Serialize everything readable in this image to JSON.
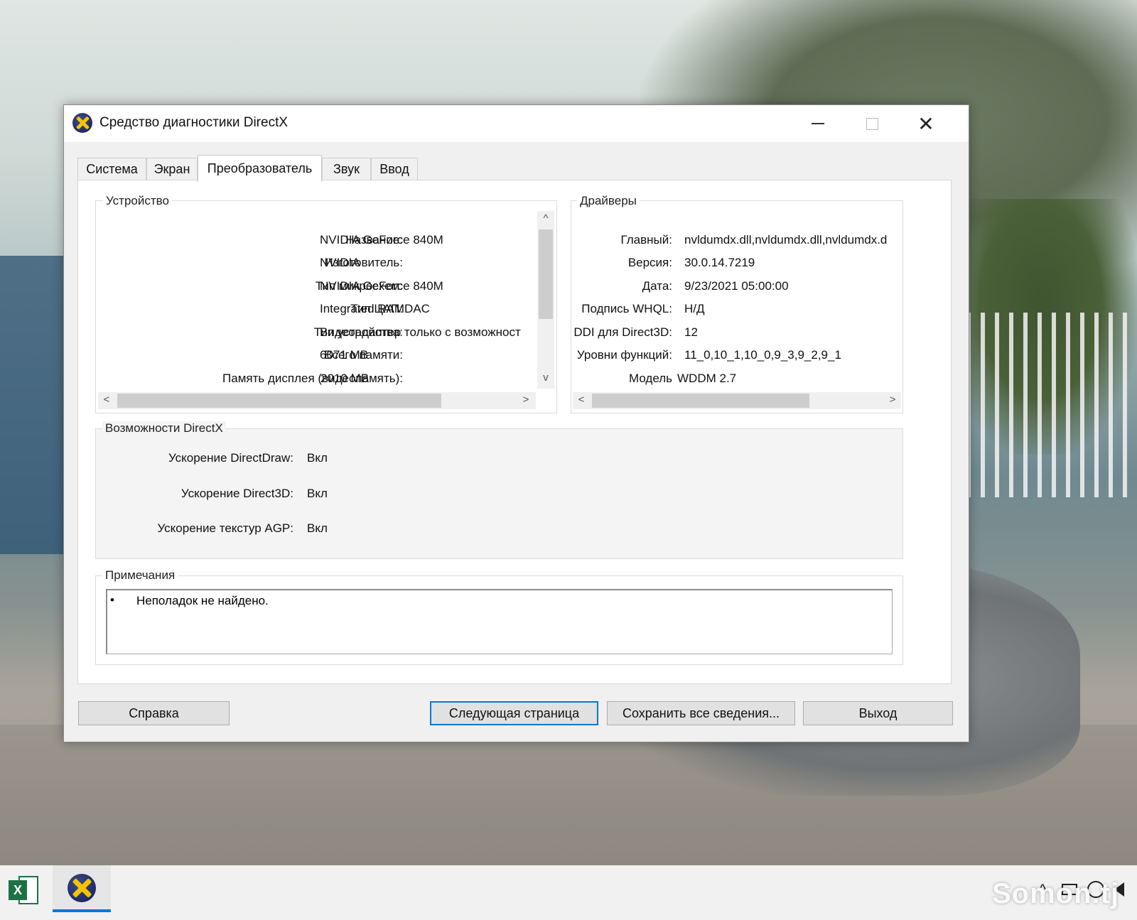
{
  "window": {
    "title": "Средство диагностики DirectX",
    "controls": {
      "minimize": "—",
      "maximize": "☐",
      "close": "✕"
    }
  },
  "tabs": [
    {
      "label": "Система",
      "active": false
    },
    {
      "label": "Экран",
      "active": false
    },
    {
      "label": "Преобразователь",
      "active": true
    },
    {
      "label": "Звук",
      "active": false
    },
    {
      "label": "Ввод",
      "active": false
    }
  ],
  "device": {
    "title": "Устройство",
    "rows": [
      {
        "label": "Название:",
        "value": "NVIDIA GeForce 840M"
      },
      {
        "label": "Изготовитель:",
        "value": "NVIDIA"
      },
      {
        "label": "Тип микросхем:",
        "value": "NVIDIA GeForce 840M"
      },
      {
        "label": "Тип ЦАП:",
        "value": "Integrated RAMDAC"
      },
      {
        "label": "Тип устройства:",
        "value": "Видеоадаптер только с возможност"
      },
      {
        "label": "Всего памяти:",
        "value": "6071 MB"
      },
      {
        "label": "Память дисплея (видеопамять):",
        "value": "2010 MB"
      }
    ]
  },
  "drivers": {
    "title": "Драйверы",
    "rows": [
      {
        "label": "Главный:",
        "value": "nvldumdx.dll,nvldumdx.dll,nvldumdx.d"
      },
      {
        "label": "Версия:",
        "value": "30.0.14.7219"
      },
      {
        "label": "Дата:",
        "value": "9/23/2021 05:00:00"
      },
      {
        "label": "Подпись WHQL:",
        "value": "Н/Д"
      },
      {
        "label": "DDI для Direct3D:",
        "value": "12"
      },
      {
        "label": "Уровни функций:",
        "value": "11_0,10_1,10_0,9_3,9_2,9_1"
      },
      {
        "label": "Модель",
        "value": "WDDM 2.7"
      }
    ]
  },
  "directx": {
    "title": "Возможности DirectX",
    "rows": [
      {
        "label": "Ускорение DirectDraw:",
        "value": "Вкл"
      },
      {
        "label": "Ускорение Direct3D:",
        "value": "Вкл"
      },
      {
        "label": "Ускорение текстур AGP:",
        "value": "Вкл"
      }
    ]
  },
  "notes": {
    "title": "Примечания",
    "bullet": "•",
    "text": "Неполадок не найдено."
  },
  "buttons": {
    "help": "Справка",
    "next": "Следующая страница",
    "save": "Сохранить все сведения...",
    "exit": "Выход"
  },
  "scroll_arrows": {
    "up": "^",
    "down": "v",
    "left": "<",
    "right": ">"
  },
  "taskbar": {
    "excel_letter": "X",
    "tray": {
      "chevron": "^"
    }
  },
  "watermark": "Somon.tj",
  "colors": {
    "accent": "#0078d7",
    "window_bg": "#f0f0f0",
    "panel_bg": "#ffffff",
    "directx_yellow": "#f5c400",
    "directx_blue": "#141d52",
    "excel_green": "#1e7145"
  },
  "icons": {
    "app": "directx-icon",
    "excel": "excel-icon",
    "taskbar_app": "directx-icon",
    "tray": [
      "chevron-up-icon",
      "monitor-icon",
      "globe-icon",
      "speaker-icon"
    ]
  }
}
